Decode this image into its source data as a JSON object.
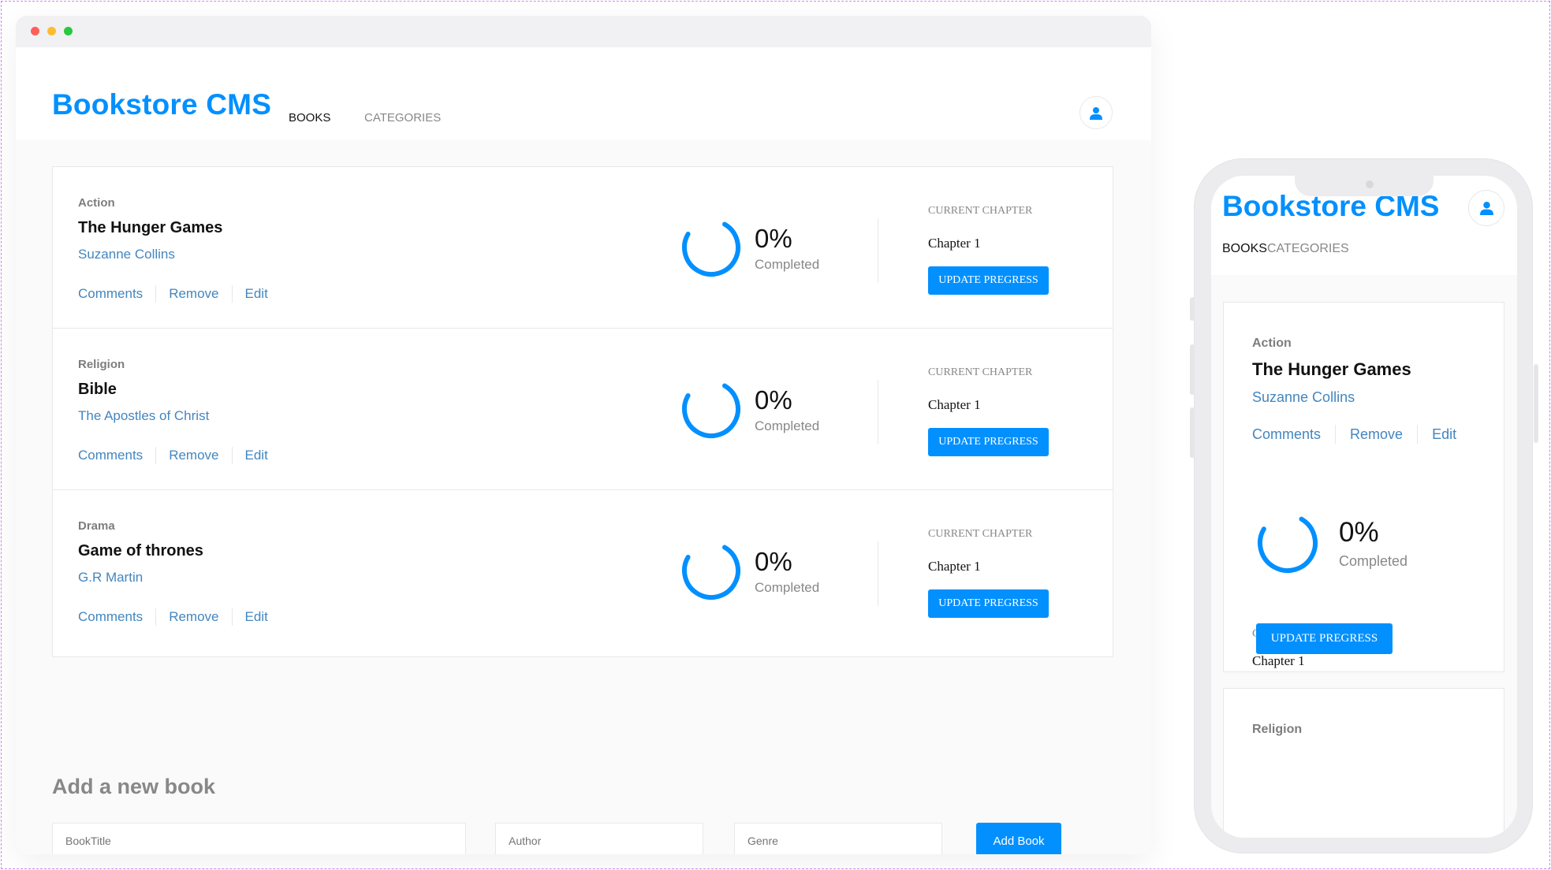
{
  "app": {
    "logo": "Bookstore CMS",
    "nav": {
      "books": "BOOKS",
      "categories": "CATEGORIES"
    },
    "accent_color": "#0290ff",
    "link_color": "#4386bf",
    "user_icon": "user-icon"
  },
  "books": [
    {
      "genre": "Action",
      "title": "The Hunger Games",
      "author": "Suzanne Collins",
      "progress_percent": 0,
      "percent_label": "0%",
      "completed_label": "Completed",
      "current_chapter_label": "CURRENT CHAPTER",
      "chapter": "Chapter 1",
      "update_label": "UPDATE PREGRESS"
    },
    {
      "genre": "Religion",
      "title": "Bible",
      "author": "The Apostles of Christ",
      "progress_percent": 0,
      "percent_label": "0%",
      "completed_label": "Completed",
      "current_chapter_label": "CURRENT CHAPTER",
      "chapter": "Chapter 1",
      "update_label": "UPDATE PREGRESS"
    },
    {
      "genre": "Drama",
      "title": "Game of thrones",
      "author": "G.R Martin",
      "progress_percent": 0,
      "percent_label": "0%",
      "completed_label": "Completed",
      "current_chapter_label": "CURRENT CHAPTER",
      "chapter": "Chapter 1",
      "update_label": "UPDATE PREGRESS"
    }
  ],
  "book_actions": {
    "comments": "Comments",
    "remove": "Remove",
    "edit": "Edit"
  },
  "add_form": {
    "heading": "Add a new book",
    "title_placeholder": "BookTitle",
    "author_placeholder": "Author",
    "genre_placeholder": "Genre",
    "submit_label": "Add Book"
  },
  "mobile": {
    "logo": "Bookstore CMS",
    "nav": {
      "books": "BOOKS",
      "categories": "CATEGORIES"
    },
    "next_card_genre": "Religion"
  }
}
